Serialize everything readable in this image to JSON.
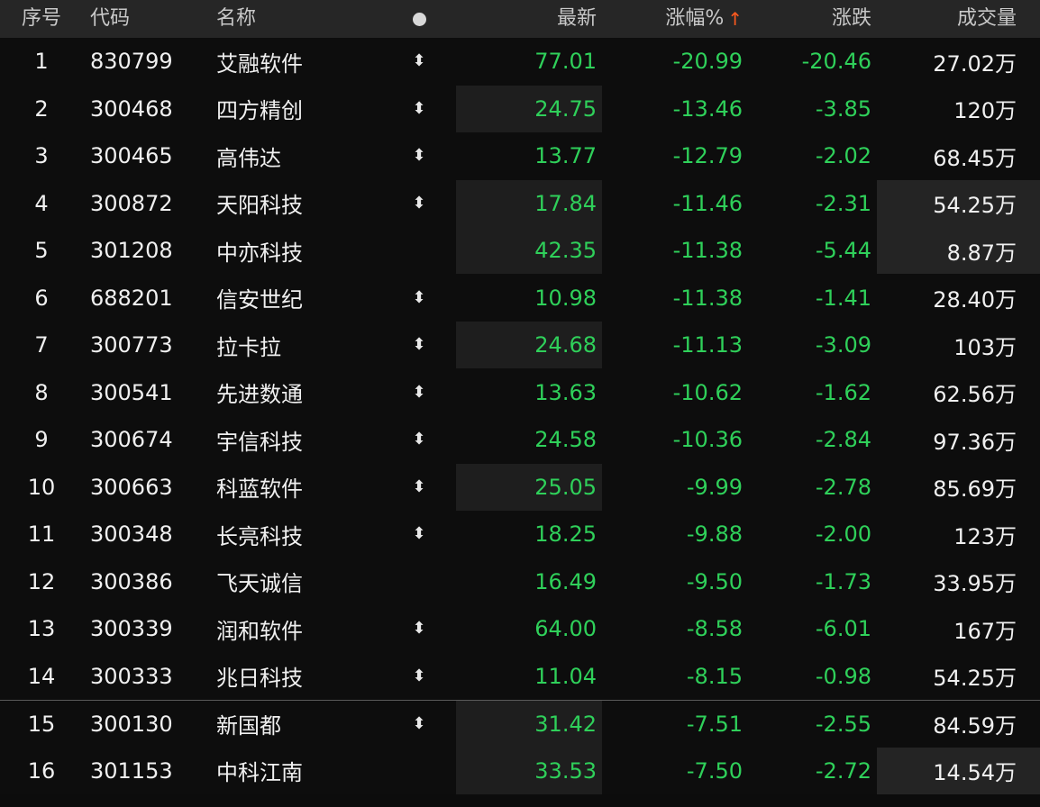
{
  "header": {
    "idx": "序号",
    "code": "代码",
    "name": "名称",
    "last": "最新",
    "pct": "涨幅%",
    "pct_arrow": "↑",
    "chg": "涨跌",
    "vol": "成交量",
    "dot_icon": "circle-dot-icon"
  },
  "rows": [
    {
      "idx": "1",
      "code": "830799",
      "name": "艾融软件",
      "flag": "⬍",
      "last": "77.01",
      "pct": "-20.99",
      "chg": "-20.46",
      "vol": "27.02万",
      "hl_last": false,
      "hl_vol": false
    },
    {
      "idx": "2",
      "code": "300468",
      "name": "四方精创",
      "flag": "⬍",
      "last": "24.75",
      "pct": "-13.46",
      "chg": "-3.85",
      "vol": "120万",
      "hl_last": true,
      "hl_vol": false
    },
    {
      "idx": "3",
      "code": "300465",
      "name": "高伟达",
      "flag": "⬍",
      "last": "13.77",
      "pct": "-12.79",
      "chg": "-2.02",
      "vol": "68.45万",
      "hl_last": false,
      "hl_vol": false
    },
    {
      "idx": "4",
      "code": "300872",
      "name": "天阳科技",
      "flag": "⬍",
      "last": "17.84",
      "pct": "-11.46",
      "chg": "-2.31",
      "vol": "54.25万",
      "hl_last": true,
      "hl_vol": true
    },
    {
      "idx": "5",
      "code": "301208",
      "name": "中亦科技",
      "flag": "",
      "last": "42.35",
      "pct": "-11.38",
      "chg": "-5.44",
      "vol": "8.87万",
      "hl_last": true,
      "hl_vol": true
    },
    {
      "idx": "6",
      "code": "688201",
      "name": "信安世纪",
      "flag": "⬍",
      "last": "10.98",
      "pct": "-11.38",
      "chg": "-1.41",
      "vol": "28.40万",
      "hl_last": false,
      "hl_vol": false
    },
    {
      "idx": "7",
      "code": "300773",
      "name": "拉卡拉",
      "flag": "⬍",
      "last": "24.68",
      "pct": "-11.13",
      "chg": "-3.09",
      "vol": "103万",
      "hl_last": true,
      "hl_vol": false
    },
    {
      "idx": "8",
      "code": "300541",
      "name": "先进数通",
      "flag": "⬍",
      "last": "13.63",
      "pct": "-10.62",
      "chg": "-1.62",
      "vol": "62.56万",
      "hl_last": false,
      "hl_vol": false
    },
    {
      "idx": "9",
      "code": "300674",
      "name": "宇信科技",
      "flag": "⬍",
      "last": "24.58",
      "pct": "-10.36",
      "chg": "-2.84",
      "vol": "97.36万",
      "hl_last": false,
      "hl_vol": false
    },
    {
      "idx": "10",
      "code": "300663",
      "name": "科蓝软件",
      "flag": "⬍",
      "last": "25.05",
      "pct": "-9.99",
      "chg": "-2.78",
      "vol": "85.69万",
      "hl_last": true,
      "hl_vol": false
    },
    {
      "idx": "11",
      "code": "300348",
      "name": "长亮科技",
      "flag": "⬍",
      "last": "18.25",
      "pct": "-9.88",
      "chg": "-2.00",
      "vol": "123万",
      "hl_last": false,
      "hl_vol": false
    },
    {
      "idx": "12",
      "code": "300386",
      "name": "飞天诚信",
      "flag": "",
      "last": "16.49",
      "pct": "-9.50",
      "chg": "-1.73",
      "vol": "33.95万",
      "hl_last": false,
      "hl_vol": false
    },
    {
      "idx": "13",
      "code": "300339",
      "name": "润和软件",
      "flag": "⬍",
      "last": "64.00",
      "pct": "-8.58",
      "chg": "-6.01",
      "vol": "167万",
      "hl_last": false,
      "hl_vol": false
    },
    {
      "idx": "14",
      "code": "300333",
      "name": "兆日科技",
      "flag": "⬍",
      "last": "11.04",
      "pct": "-8.15",
      "chg": "-0.98",
      "vol": "54.25万",
      "hl_last": false,
      "hl_vol": false
    },
    {
      "idx": "15",
      "code": "300130",
      "name": "新国都",
      "flag": "⬍",
      "last": "31.42",
      "pct": "-7.51",
      "chg": "-2.55",
      "vol": "84.59万",
      "hl_last": true,
      "hl_vol": false
    },
    {
      "idx": "16",
      "code": "301153",
      "name": "中科江南",
      "flag": "",
      "last": "33.53",
      "pct": "-7.50",
      "chg": "-2.72",
      "vol": "14.54万",
      "hl_last": true,
      "hl_vol": true
    }
  ],
  "colors": {
    "header_bg": "#262626",
    "row_bg": "#0d0d0d",
    "down_green": "#2fd05a",
    "sort_arrow": "#ff5a1f"
  }
}
